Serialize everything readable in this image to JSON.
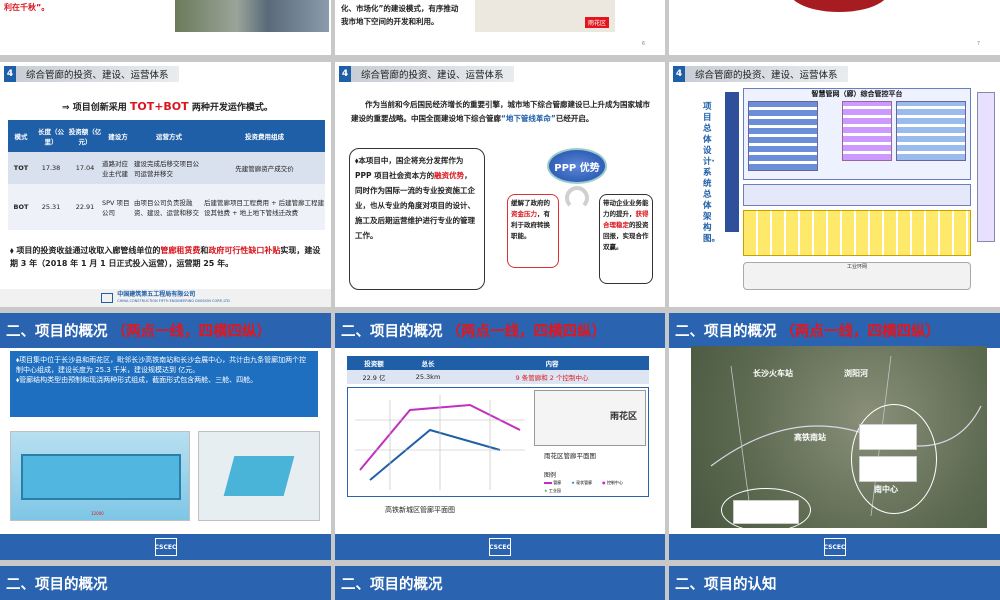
{
  "top": {
    "s1_text": "利在千秋”。",
    "s2_line1": "化、市场化”的建设模式，有序推动",
    "s2_line2": "我市地下空间的开发和利用。",
    "s2_page": "6",
    "s2_map_label": "雨花区",
    "s3_page": "7"
  },
  "section_title": "综合管廊的投资、建设、运营体系",
  "section_num": "4",
  "slide4": {
    "intro_pre": "项目创新采用",
    "intro_hl": "TOT+BOT",
    "intro_post": "两种开发运作模式。",
    "headers": [
      "模式",
      "长度（公里）",
      "投资额（亿元）",
      "建设方",
      "运营方式",
      "投资费用组成"
    ],
    "rows": [
      [
        "TOT",
        "17.38",
        "17.04",
        "道路对应业主代建",
        "建设完成后移交项目公司运营并移交",
        "先建管廊资产成交价"
      ],
      [
        "BOT",
        "25.31",
        "22.91",
        "SPV 项目公司",
        "由项目公司负责投融资、建设、运营和移交",
        "后建管廊项目工程费用 + 后建管廊工程建设其他费 + 地上地下管线迁改费"
      ]
    ],
    "note_pre": "项目的投资收益通过收取入廊管线单位的",
    "note_red1": "管廊租赁费",
    "note_mid": "和",
    "note_red2": "政府可行性缺口补贴",
    "note_post": "实现，建设期 3 年（2018 年 1 月 1 日正式投入运营），运营期 25 年。",
    "company_cn": "中国建筑第五工程局有限公司",
    "company_en": "CHINA CONSTRUCTION FIFTH ENGINEERING DIVISION CORP.,LTD"
  },
  "slide5": {
    "para_pre": "作为当前和今后国民经济增长的重要引擎，城市地下综合管廊建设已上升成为国家城市建设的重要战略。中国全面建设地下综合管廊",
    "para_hl": "“地下管线革命”",
    "para_post": "已经开启。",
    "box_pre": "本项目中，国企将充分发挥作为 PPP 项目社会资本方的",
    "box_hl": "融资优势",
    "box_post": "，同时作为国际一流的专业投资施工企业，也从专业的角度对项目的设计、施工及后期运营维护进行专业的管理工作。",
    "bubble": "PPP 优势",
    "left_pre": "缓解了政府的",
    "left_red": "资金压力",
    "left_post": "，有利于政府转换职能。",
    "right_pre": "带动企业业务能力的提升，",
    "right_red": "获得合理稳定",
    "right_post": "的投资回报，实现合作双赢。"
  },
  "slide6": {
    "vertical_text": "项目总体设计·系统总体架构图。",
    "platform_title": "智慧管网（廊）综合管控平台",
    "bottom_label": "工业环网"
  },
  "row2": {
    "title": "二、项目的概况",
    "title_red": "（两点一线，四横四纵）"
  },
  "slide7": {
    "bullet1": "项目集中位于长沙县和雨花区，毗邻长沙高铁南站和长沙会展中心，共计由九条管廊加两个控制中心组成，建设长度为 25.3 千米，建设规模达到 亿元。",
    "bullet2": "管廊结构类型由预制和现浇两种形式组成，截面形式包含两舱、三舱、四舱。",
    "dim": "12000"
  },
  "slide8": {
    "headers": [
      "投资额",
      "总长",
      "内容"
    ],
    "values": [
      "22.9 亿",
      "25.3km",
      "9 条管廊和 2 个控制中心"
    ],
    "map_left_label": "高铁新城区管廊平面图",
    "map_right_label": "雨花区管廊平面图",
    "legend_title": "图例",
    "legend": [
      "管廊",
      "现状管廊",
      "控制中心",
      "工业园"
    ],
    "map_right_text": "雨花区"
  },
  "slide9": {
    "labels": [
      "长沙火车站",
      "浏阳河",
      "高铁南站",
      "南中心"
    ]
  },
  "row3": {
    "t1": "二、项目的概况",
    "t2": "二、项目的概况",
    "t3": "二、项目的认知"
  },
  "footer_logo": "CSCEC"
}
